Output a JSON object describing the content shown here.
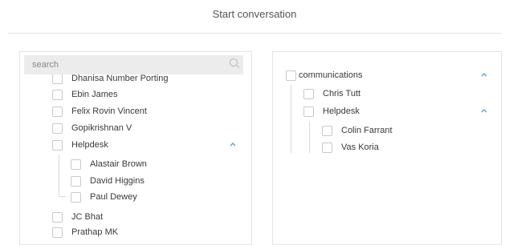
{
  "header": {
    "title": "Start conversation"
  },
  "left_panel": {
    "search_placeholder": "search",
    "items": {
      "dhanisa": "Dhanisa Number Porting",
      "ebin": "Ebin James",
      "felix": "Felix Rovin Vincent",
      "gopi": "Gopikrishnan V",
      "helpdesk": "Helpdesk",
      "alastair": "Alastair Brown",
      "david": "David Higgins",
      "paul": "Paul Dewey",
      "jc": "JC Bhat",
      "prathap": "Prathap MK"
    }
  },
  "right_panel": {
    "items": {
      "communications": "communications",
      "chris": "Chris Tutt",
      "helpdesk": "Helpdesk",
      "colin": "Colin Farrant",
      "vas": "Vas Koria"
    }
  },
  "icons": {
    "search": "search-icon",
    "chevron": "chevron-up-icon"
  },
  "colors": {
    "accent": "#4aa3d8",
    "checkbox_border": "#c9c9c9",
    "search_bg": "#ececec"
  }
}
